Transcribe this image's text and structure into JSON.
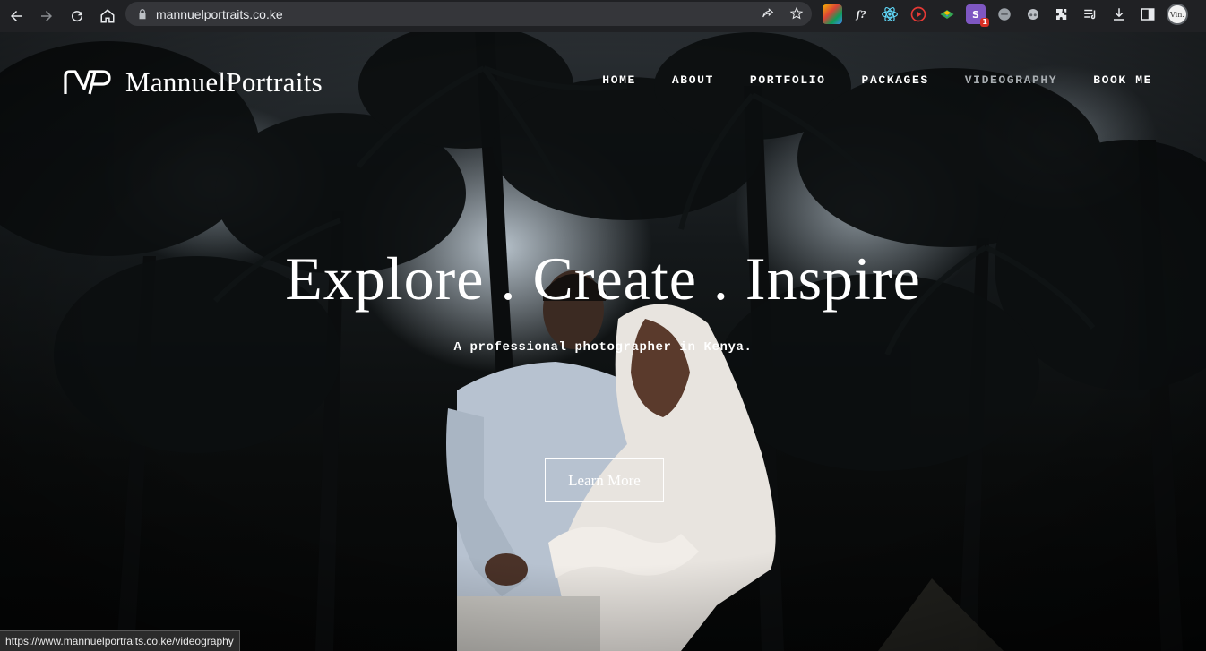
{
  "browser": {
    "url": "mannuelportraits.co.ke",
    "profile_initials": "Vin.",
    "extension_badge": "1"
  },
  "site": {
    "brand": "MannuelPortraits",
    "nav": [
      {
        "label": "HOME",
        "hovered": false
      },
      {
        "label": "ABOUT",
        "hovered": false
      },
      {
        "label": "PORTFOLIO",
        "hovered": false
      },
      {
        "label": "PACKAGES",
        "hovered": false
      },
      {
        "label": "VIDEOGRAPHY",
        "hovered": true
      },
      {
        "label": "BOOK ME",
        "hovered": false
      }
    ],
    "hero": {
      "headline": "Explore . Create . Inspire",
      "tagline": "A professional photographer in Kenya.",
      "cta_label": "Learn More"
    }
  },
  "status_bar": {
    "link_preview": "https://www.mannuelportraits.co.ke/videography"
  },
  "colors": {
    "chrome_bg": "#202124",
    "omnibox_bg": "#35363a",
    "nav_hover": "#a8adb1",
    "text_light": "#ffffff"
  }
}
